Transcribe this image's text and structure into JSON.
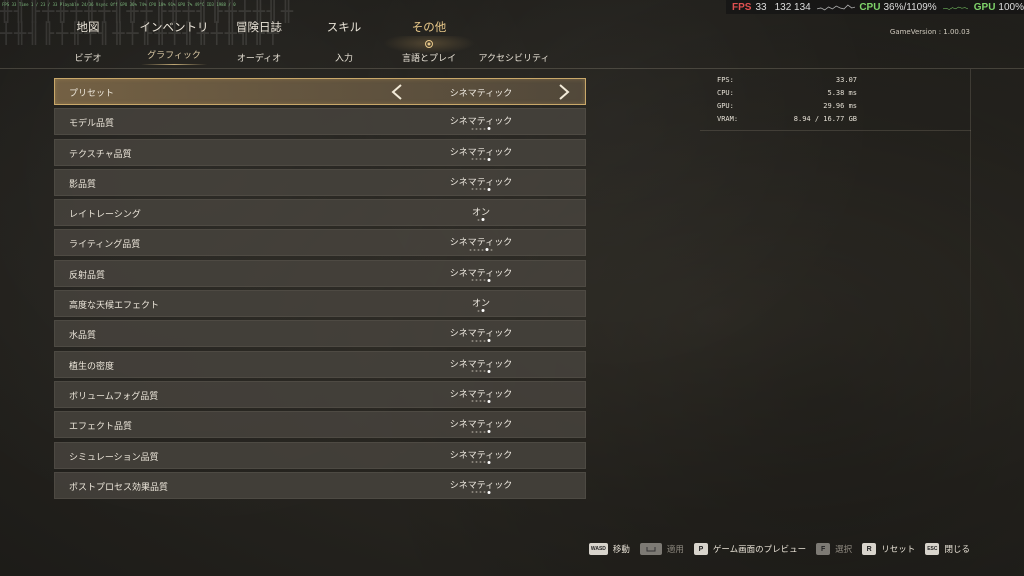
{
  "debug": {
    "overlay_text": "FPS 33   Time 1 / 23 / 33   Playable 24/36   Vsync 0ff   GPU 36% 74%   CPU 18% 91%   GPU 7% 49°C   ID3 1988 / 0"
  },
  "perf_overlay": {
    "fps_label": "FPS",
    "fps_value": "33",
    "fps_range": "132 134",
    "cpu_label": "CPU",
    "cpu_value": "36%/1109%",
    "gpu_label": "GPU",
    "gpu_value": "100%",
    "fps_color": "#e05050",
    "cpu_gpu_color": "#7fd36a"
  },
  "nav": {
    "main_tabs": [
      {
        "label": "地図"
      },
      {
        "label": "インベントリ"
      },
      {
        "label": "冒険日誌"
      },
      {
        "label": "スキル"
      },
      {
        "label": "その他"
      }
    ],
    "active_main_tab": "その他",
    "sub_tabs": [
      {
        "label": "ビデオ"
      },
      {
        "label": "グラフィック"
      },
      {
        "label": "オーディオ"
      },
      {
        "label": "入力"
      },
      {
        "label": "言語とプレイ"
      },
      {
        "label": "アクセシビリティ"
      }
    ],
    "active_sub_tab": "グラフィック",
    "accent_color": "#e9c98a"
  },
  "game_version": "GameVersion : 1.00.03",
  "settings": [
    {
      "label": "プリセット",
      "value": "シネマティック",
      "selected": true
    },
    {
      "label": "モデル品質",
      "value": "シネマティック",
      "levels": 5,
      "level": 5
    },
    {
      "label": "テクスチャ品質",
      "value": "シネマティック",
      "levels": 5,
      "level": 5
    },
    {
      "label": "影品質",
      "value": "シネマティック",
      "levels": 5,
      "level": 5
    },
    {
      "label": "レイトレーシング",
      "value": "オン",
      "levels": 2,
      "level": 2
    },
    {
      "label": "ライティング品質",
      "value": "シネマティック",
      "levels": 6,
      "level": 5
    },
    {
      "label": "反射品質",
      "value": "シネマティック",
      "levels": 5,
      "level": 5
    },
    {
      "label": "高度な天候エフェクト",
      "value": "オン",
      "levels": 2,
      "level": 2
    },
    {
      "label": "水品質",
      "value": "シネマティック",
      "levels": 5,
      "level": 5
    },
    {
      "label": "植生の密度",
      "value": "シネマティック",
      "levels": 5,
      "level": 5
    },
    {
      "label": "ボリュームフォグ品質",
      "value": "シネマティック",
      "levels": 5,
      "level": 5
    },
    {
      "label": "エフェクト品質",
      "value": "シネマティック",
      "levels": 5,
      "level": 5
    },
    {
      "label": "シミュレーション品質",
      "value": "シネマティック",
      "levels": 5,
      "level": 5
    },
    {
      "label": "ポストプロセス効果品質",
      "value": "シネマティック",
      "levels": 5,
      "level": 5
    }
  ],
  "perf_panel": [
    {
      "key": "FPS:",
      "value": "33.07"
    },
    {
      "key": "CPU:",
      "value": "5.38 ms"
    },
    {
      "key": "GPU:",
      "value": "29.96 ms"
    },
    {
      "key": "VRAM:",
      "value": "8.94 / 16.77 GB"
    }
  ],
  "hints": [
    {
      "key": "WASD",
      "label": "移動",
      "enabled": true
    },
    {
      "key": "",
      "label": "適用",
      "enabled": false
    },
    {
      "key": "P",
      "label": "ゲーム画面のプレビュー",
      "enabled": true
    },
    {
      "key": "F",
      "label": "選択",
      "enabled": false
    },
    {
      "key": "R",
      "label": "リセット",
      "enabled": true
    },
    {
      "key": "ESC",
      "label": "閉じる",
      "enabled": true
    }
  ]
}
